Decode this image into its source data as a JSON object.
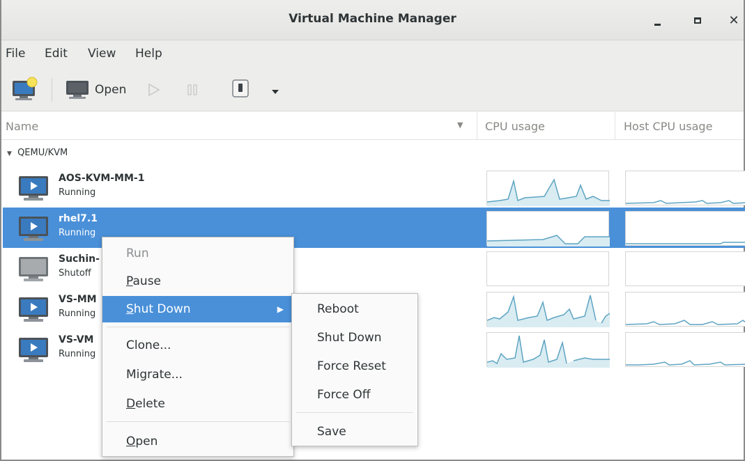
{
  "window": {
    "title": "Virtual Machine Manager"
  },
  "menubar": [
    "File",
    "Edit",
    "View",
    "Help"
  ],
  "toolbar": {
    "open_label": "Open"
  },
  "columns": {
    "name": "Name",
    "cpu": "CPU usage",
    "host_cpu": "Host CPU usage"
  },
  "connection": "QEMU/KVM",
  "vms": [
    {
      "name": "AOS-KVM-MM-1",
      "status": "Running",
      "icon": "running-vm-icon"
    },
    {
      "name": "rhel7.1",
      "status": "Running",
      "icon": "running-vm-icon"
    },
    {
      "name": "Suchin-",
      "status": "Shutoff",
      "icon": "shutoff-vm-icon"
    },
    {
      "name": "VS-MM",
      "status": "Running",
      "icon": "running-vm-icon"
    },
    {
      "name": "VS-VM",
      "status": "Running",
      "icon": "running-vm-icon"
    }
  ],
  "context_menu": {
    "items": [
      "Run",
      "Pause",
      "Shut Down",
      "Clone...",
      "Migrate...",
      "Delete",
      "Open"
    ],
    "disabled": [
      "Run"
    ],
    "highlighted": "Shut Down"
  },
  "shutdown_submenu": [
    "Reboot",
    "Shut Down",
    "Force Reset",
    "Force Off",
    "Save"
  ],
  "colors": {
    "selection": "#4a90d9",
    "graph_line": "#5da4c2",
    "graph_fill": "#d9ecf2"
  }
}
